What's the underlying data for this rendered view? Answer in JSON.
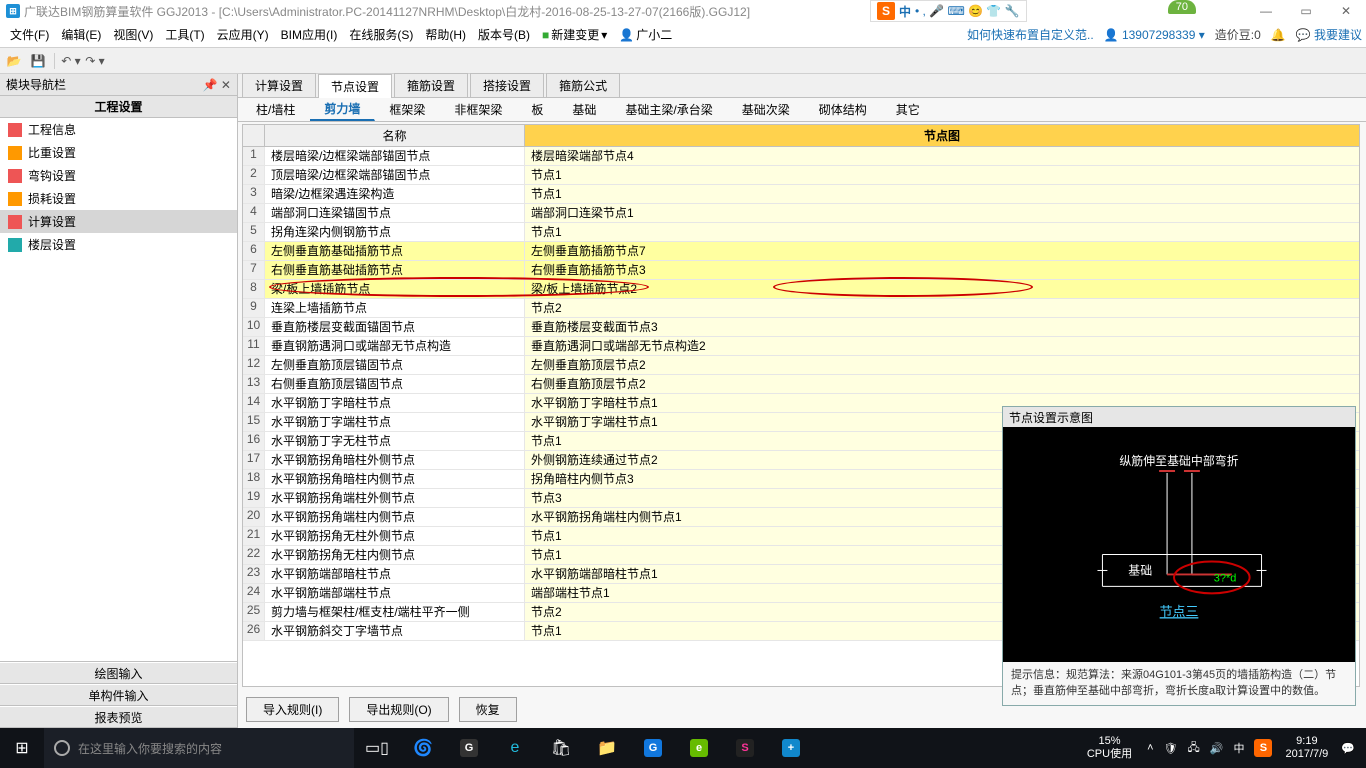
{
  "titlebar": {
    "app_title": "广联达BIM钢筋算量软件 GGJ2013 - [C:\\Users\\Administrator.PC-20141127NRHM\\Desktop\\白龙村-2016-08-25-13-27-07(2166版).GGJ12]"
  },
  "ime": {
    "s": "S",
    "zhong": "中",
    "icons": "• , 🎤 ⌨ 😊 👕 🔧"
  },
  "green_badge": "70",
  "menu": {
    "items": [
      "文件(F)",
      "编辑(E)",
      "视图(V)",
      "工具(T)",
      "云应用(Y)",
      "BIM应用(I)",
      "在线服务(S)",
      "帮助(H)",
      "版本号(B)"
    ],
    "new_change": "新建变更",
    "user_small": "广小二",
    "tip_link": "如何快速布置自定义范..",
    "phone": "13907298339",
    "coin_label": "造价豆:0",
    "feedback": "我要建议"
  },
  "left_panel": {
    "header": "模块导航栏",
    "section": "工程设置",
    "items": [
      "工程信息",
      "比重设置",
      "弯钩设置",
      "损耗设置",
      "计算设置",
      "楼层设置"
    ],
    "bottom": [
      "绘图输入",
      "单构件输入",
      "报表预览"
    ]
  },
  "tabs": [
    "计算设置",
    "节点设置",
    "箍筋设置",
    "搭接设置",
    "箍筋公式"
  ],
  "subtabs": [
    "柱/墙柱",
    "剪力墙",
    "框架梁",
    "非框架梁",
    "板",
    "基础",
    "基础主梁/承台梁",
    "基础次梁",
    "砌体结构",
    "其它"
  ],
  "grid": {
    "col_name": "名称",
    "col_node": "节点图",
    "rows": [
      {
        "n": 1,
        "name": "楼层暗梁/边框梁端部锚固节点",
        "node": "楼层暗梁端部节点4"
      },
      {
        "n": 2,
        "name": "顶层暗梁/边框梁端部锚固节点",
        "node": "节点1"
      },
      {
        "n": 3,
        "name": "暗梁/边框梁遇连梁构造",
        "node": "节点1"
      },
      {
        "n": 4,
        "name": "端部洞口连梁锚固节点",
        "node": "端部洞口连梁节点1"
      },
      {
        "n": 5,
        "name": "拐角连梁内侧钢筋节点",
        "node": "节点1"
      },
      {
        "n": 6,
        "name": "左侧垂直筋基础插筋节点",
        "node": "左侧垂直筋插筋节点7"
      },
      {
        "n": 7,
        "name": "右侧垂直筋基础插筋节点",
        "node": "右侧垂直筋插筋节点3"
      },
      {
        "n": 8,
        "name": "梁/板上墙插筋节点",
        "node": "梁/板上墙插筋节点2"
      },
      {
        "n": 9,
        "name": "连梁上墙插筋节点",
        "node": "节点2"
      },
      {
        "n": 10,
        "name": "垂直筋楼层变截面锚固节点",
        "node": "垂直筋楼层变截面节点3"
      },
      {
        "n": 11,
        "name": "垂直钢筋遇洞口或端部无节点构造",
        "node": "垂直筋遇洞口或端部无节点构造2"
      },
      {
        "n": 12,
        "name": "左侧垂直筋顶层锚固节点",
        "node": "左侧垂直筋顶层节点2"
      },
      {
        "n": 13,
        "name": "右侧垂直筋顶层锚固节点",
        "node": "右侧垂直筋顶层节点2"
      },
      {
        "n": 14,
        "name": "水平钢筋丁字暗柱节点",
        "node": "水平钢筋丁字暗柱节点1"
      },
      {
        "n": 15,
        "name": "水平钢筋丁字端柱节点",
        "node": "水平钢筋丁字端柱节点1"
      },
      {
        "n": 16,
        "name": "水平钢筋丁字无柱节点",
        "node": "节点1"
      },
      {
        "n": 17,
        "name": "水平钢筋拐角暗柱外侧节点",
        "node": "外侧钢筋连续通过节点2"
      },
      {
        "n": 18,
        "name": "水平钢筋拐角暗柱内侧节点",
        "node": "拐角暗柱内侧节点3"
      },
      {
        "n": 19,
        "name": "水平钢筋拐角端柱外侧节点",
        "node": "节点3"
      },
      {
        "n": 20,
        "name": "水平钢筋拐角端柱内侧节点",
        "node": "水平钢筋拐角端柱内侧节点1"
      },
      {
        "n": 21,
        "name": "水平钢筋拐角无柱外侧节点",
        "node": "节点1"
      },
      {
        "n": 22,
        "name": "水平钢筋拐角无柱内侧节点",
        "node": "节点1"
      },
      {
        "n": 23,
        "name": "水平钢筋端部暗柱节点",
        "node": "水平钢筋端部暗柱节点1"
      },
      {
        "n": 24,
        "name": "水平钢筋端部端柱节点",
        "node": "端部端柱节点1"
      },
      {
        "n": 25,
        "name": "剪力墙与框架柱/框支柱/端柱平齐一侧",
        "node": "节点2"
      },
      {
        "n": 26,
        "name": "水平钢筋斜交丁字墙节点",
        "node": "节点1"
      }
    ]
  },
  "actions": {
    "import": "导入规则(I)",
    "export": "导出规则(O)",
    "restore": "恢复"
  },
  "diagram": {
    "title": "节点设置示意图",
    "text_top": "纵筋伸至基础中部弯折",
    "text_base": "基础",
    "text_dim": "3?*d",
    "link": "节点三",
    "hint": "提示信息：规范算法：来源04G101-3第45页的墙插筋构造（二）节点；垂直筋伸至基础中部弯折，弯折长度a取计算设置中的数值。"
  },
  "taskbar": {
    "search_placeholder": "在这里输入你要搜索的内容",
    "cpu_pct": "15%",
    "cpu_label": "CPU使用",
    "zhong": "中",
    "time": "9:19",
    "date": "2017/7/9"
  }
}
